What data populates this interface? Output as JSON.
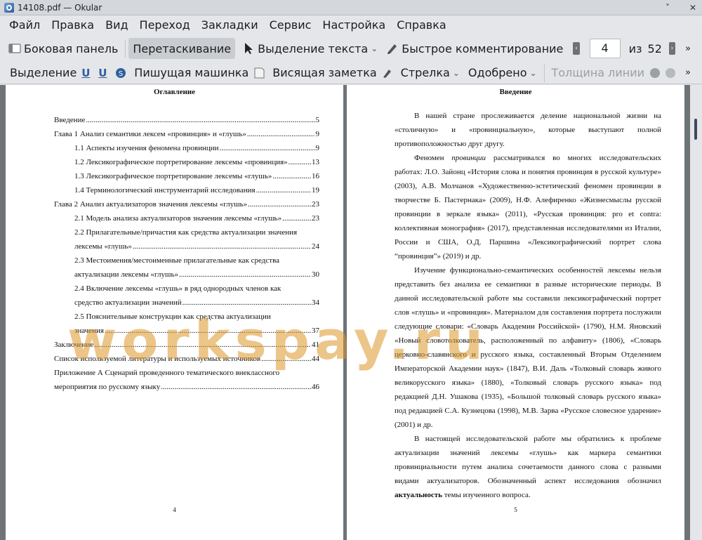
{
  "window": {
    "title": "14108.pdf  — Okular"
  },
  "menu": [
    "Файл",
    "Правка",
    "Вид",
    "Переход",
    "Закладки",
    "Сервис",
    "Настройка",
    "Справка"
  ],
  "toolbar1": {
    "sidebar": "Боковая панель",
    "drag": "Перетаскивание",
    "select_text": "Выделение текста",
    "quick_comment": "Быстрое комментирование",
    "page_current": "4",
    "page_of": "из",
    "page_total": "52"
  },
  "toolbar2": {
    "selection": "Выделение",
    "typewriter": "Пишущая машинка",
    "note": "Висящая заметка",
    "arrow": "Стрелка",
    "approved": "Одобрено",
    "line_width": "Толщина линии"
  },
  "left_page": {
    "heading": "Оглавление",
    "page_number": "4",
    "toc": [
      {
        "text": "Введение",
        "page": "5",
        "indent": false
      },
      {
        "text": "Глава 1 Анализ семантики лексем «провинция» и «глушь»",
        "page": "9",
        "indent": false
      },
      {
        "text": "1.1 Аспекты изучения феномена провинции",
        "page": "9",
        "indent": true
      },
      {
        "text": "1.2 Лексикографическое портретирование лексемы «провинция»",
        "page": "13",
        "indent": true
      },
      {
        "text": "1.3 Лексикографическое портретирование лексемы «глушь»",
        "page": "16",
        "indent": true
      },
      {
        "text": "1.4 Терминологический инструментарий исследования",
        "page": "19",
        "indent": true
      },
      {
        "text": "Глава 2 Анализ актуализаторов значения лексемы «глушь»",
        "page": "23",
        "indent": false
      },
      {
        "text": "2.1 Модель анализа актуализаторов значения лексемы «глушь»",
        "page": "23",
        "indent": true
      },
      {
        "line1": "2.2 Прилагательные/причастия как средства актуализации значения",
        "text": "лексемы «глушь»",
        "page": "24",
        "indent": true
      },
      {
        "line1": "2.3 Местоимения/местоименные прилагательные как средства",
        "text": "актуализации лексемы «глушь»",
        "page": "30",
        "indent": true
      },
      {
        "line1": "2.4 Включение лексемы «глушь» в ряд однородных членов как",
        "text": "средство актуализации значений",
        "page": "34",
        "indent": true
      },
      {
        "line1": "2.5 Пояснительные конструкции как средства актуализации",
        "text": "значения",
        "page": "37",
        "indent": true
      },
      {
        "text": "Заключение",
        "page": "41",
        "indent": false
      },
      {
        "text": "Список используемой литературы и используемых источников",
        "page": "44",
        "indent": false
      },
      {
        "line1": "Приложение А Сценарий проведенного тематического внеклассного",
        "text": "мероприятия по русскому языку",
        "page": "46",
        "indent": false
      }
    ]
  },
  "right_page": {
    "heading": "Введение",
    "page_number": "5",
    "p1": "В нашей стране прослеживается деление национальной жизни на «столичную» и «провинциальную», которые выступают полной противоположностью друг другу.",
    "p2_a": "Феномен ",
    "p2_em": "провинции",
    "p2_b": " рассматривался во многих исследовательских работах: Л.О. Зайонц «История слова и понятия провинция в русской культуре» (2003), А.В. Молчанов «Художественно-эстетический феномен провинции в творчестве Б. Пастернака» (2009), Н.Ф. Алефиренко «Жизнесмыслы русской провинции в зеркале языка» (2011), «Русская провинция: pro et contra: коллективная монография» (2017), представленная исследователями из Италии, России и США, О.Д. Паршина «Лексикографический портрет слова “провинция”» (2019) и др.",
    "p3": "Изучение функционально-семантических особенностей лексемы нельзя представить без анализа ее семантики в разные исторические периоды. В данной исследовательской работе мы составили лексикографический портрет слов «глушь» и «провинция». Материалом для составления портрета послужили следующие словари: «Словарь Академии Российской» (1790), Н.М. Яновский «Новый словотолкователь, расположенный по алфавиту» (1806), «Словарь церковно-славянского и русского языка, составленный Вторым Отделением Императорской Академии наук» (1847), В.И. Даль «Толковый словарь живого великорусского языка» (1880), «Толковый словарь русского языка» под редакцией Д.Н. Ушакова (1935), «Большой толковый словарь русского языка» под редакцией С.А. Кузнецова (1998), М.В. Зарва «Русское словесное ударение» (2001) и др.",
    "p4_a": "В настоящей исследовательской работе мы обратились  к проблеме актуализации значений лексемы «глушь» как маркера семантики провинциальности путем анализа сочетаемости данного слова с разными видами актуализаторов. Обозначенный аспект исследования обозначил ",
    "p4_strong": "актуальность",
    "p4_b": " темы изученного вопроса."
  },
  "watermark": "workspay.ru"
}
